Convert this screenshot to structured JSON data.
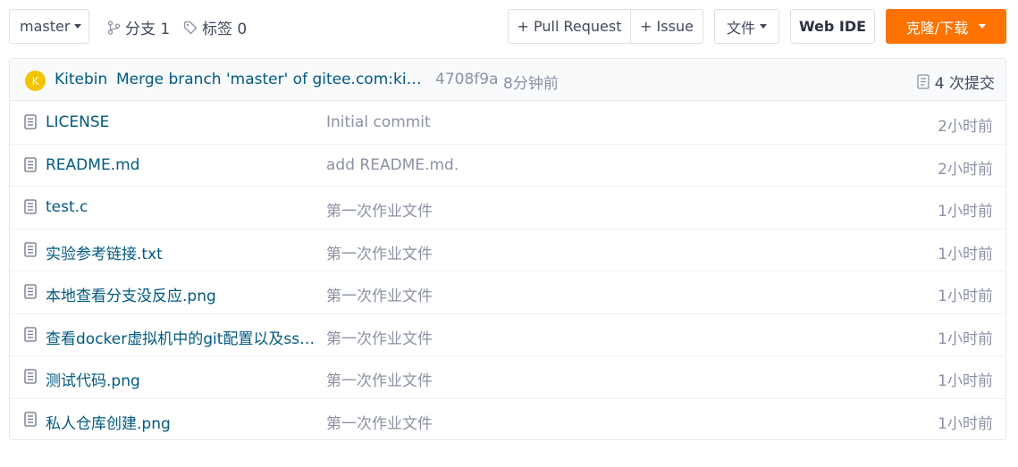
{
  "toolbar": {
    "branch_selector": "master",
    "branches_label": "分支 1",
    "tags_label": "标签 0",
    "pull_request_label": "+ Pull Request",
    "issue_label": "+ Issue",
    "file_menu_label": "文件",
    "web_ide_label": "Web IDE",
    "clone_label": "克隆/下载"
  },
  "commit": {
    "avatar_letter": "K",
    "author": "Kitebin",
    "message": "Merge branch 'master' of gitee.com:kitebin/repo",
    "sha": "4708f9a",
    "time": "8分钟前",
    "count_label": "4 次提交"
  },
  "files": [
    {
      "name": "LICENSE",
      "message": "Initial commit",
      "time": "2小时前"
    },
    {
      "name": "README.md",
      "message": "add README.md.",
      "time": "2小时前"
    },
    {
      "name": "test.c",
      "message": "第一次作业文件",
      "time": "1小时前"
    },
    {
      "name": "实验参考链接.txt",
      "message": "第一次作业文件",
      "time": "1小时前"
    },
    {
      "name": "本地查看分支没反应.png",
      "message": "第一次作业文件",
      "time": "1小时前"
    },
    {
      "name": "查看docker虚拟机中的git配置以及ssh...",
      "message": "第一次作业文件",
      "time": "1小时前"
    },
    {
      "name": "测试代码.png",
      "message": "第一次作业文件",
      "time": "1小时前"
    },
    {
      "name": "私人仓库创建.png",
      "message": "第一次作业文件",
      "time": "1小时前"
    }
  ],
  "colors": {
    "accent": "#fe7300",
    "link": "#005980",
    "muted": "#8c92a4",
    "avatar": "#f5c400"
  }
}
